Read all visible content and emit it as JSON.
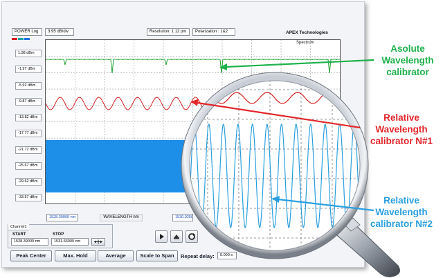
{
  "toolbar": {
    "scale_type": "POWER Log",
    "scale_div": "3.95 dB/div",
    "resolution": "Resolution: 1.12 pm",
    "polarization": "Polarization : 1&2",
    "brand": "APEX Technologies",
    "trace_name": "Spectrum"
  },
  "y_ticks": [
    "1.98 dBm",
    "-1.97 dBm",
    "-5.92 dBm",
    "-9.87 dBm",
    "-13.82 dBm",
    "-17.77 dBm",
    "-21.72 dBm",
    "-25.67 dBm",
    "-29.62 dBm",
    "-33.57 dBm"
  ],
  "x_axis": {
    "start": "1528.39000 nm",
    "label": "WAVELENGTH nm",
    "center": "1530.0250"
  },
  "channel_panel": {
    "tab": "Channel1",
    "start_label": "START",
    "start_value": "1528.39000 nm",
    "stop_label": "STOP",
    "stop_value": "1531.66000 nm"
  },
  "buttons": {
    "peak_center": "Peak Center",
    "max_hold": "Max. Hold",
    "average": "Average",
    "scale_to_span": "Scale to Span",
    "repeat_delay_label": "Repeat delay:",
    "repeat_delay_value": "0.000 s"
  },
  "annotations": {
    "absolute": [
      "Asolute",
      "Wavelength",
      "calibrator"
    ],
    "relative1": [
      "Relative",
      "Wavelength",
      "calibrator N#1"
    ],
    "relative2": [
      "Relative",
      "Wavelength",
      "calibrator N#2"
    ]
  },
  "colors": {
    "absolute": "#1db24a",
    "relative1": "#e3262a",
    "relative2": "#2a9fe0",
    "trace_green": "#2aa63c",
    "trace_red": "#d42020",
    "trace_blue": "#1e8fe8"
  }
}
